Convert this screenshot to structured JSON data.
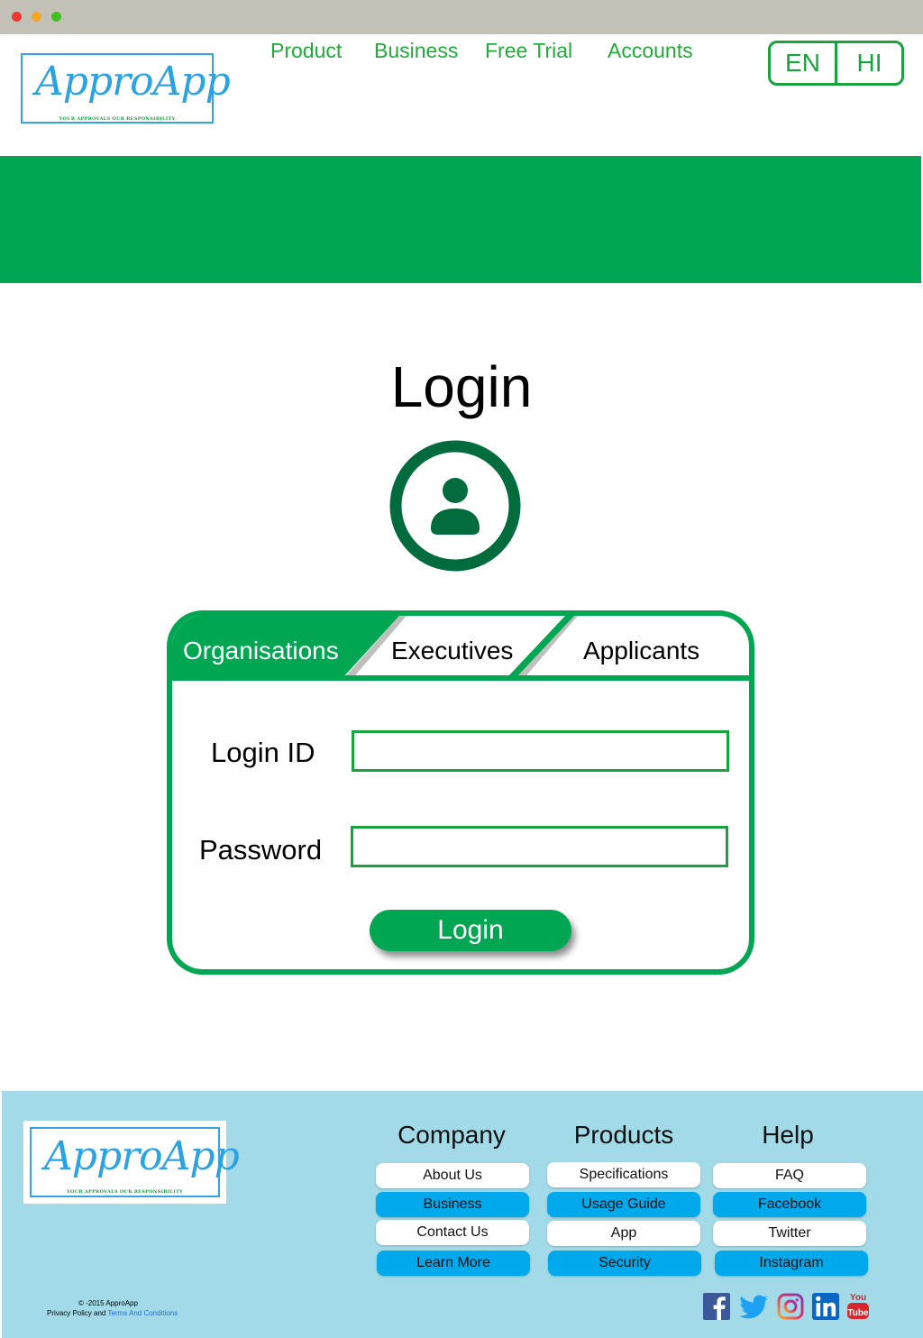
{
  "logo": {
    "text": "ApproApp",
    "tagline": "YOUR APPROVALS OUR RESPONSIBILITY"
  },
  "nav": {
    "items": [
      "Product",
      "Business",
      "Free Trial",
      "Accounts"
    ]
  },
  "language": {
    "options": [
      "EN",
      "HI"
    ]
  },
  "main": {
    "title": "Login",
    "tabs": [
      {
        "label": "Organisations",
        "active": true
      },
      {
        "label": "Executives",
        "active": false
      },
      {
        "label": "Applicants",
        "active": false
      }
    ],
    "login_id_label": "Login ID",
    "password_label": "Password",
    "login_id_value": "",
    "password_value": "",
    "login_button": "Login"
  },
  "footer": {
    "logo_text": "ApproApp",
    "tagline": "YOUR APPROVALS OUR RESPONSIBILITY",
    "columns": [
      {
        "title": "Company",
        "links": [
          "About Us",
          "Business",
          "Contact Us",
          "Learn More"
        ]
      },
      {
        "title": "Products",
        "links": [
          "Specifications",
          "Usage Guide",
          "App",
          "Security"
        ]
      },
      {
        "title": "Help",
        "links": [
          "FAQ",
          "Facebook",
          "Twitter",
          "Instagram"
        ]
      }
    ],
    "copyright": "© -2015  ApproApp",
    "privacy_text": "Privacy Policy and",
    "terms_text": "Terms And Conditions",
    "social_icons": [
      "facebook-icon",
      "twitter-icon",
      "instagram-icon",
      "linkedin-icon",
      "youtube-icon"
    ]
  },
  "colors": {
    "brand_green": "#00a651",
    "nav_green": "#22aa3a",
    "logo_blue": "#2aa3e5",
    "footer_bg": "#a2dae8",
    "footer_button_blue": "#00a8ec"
  }
}
